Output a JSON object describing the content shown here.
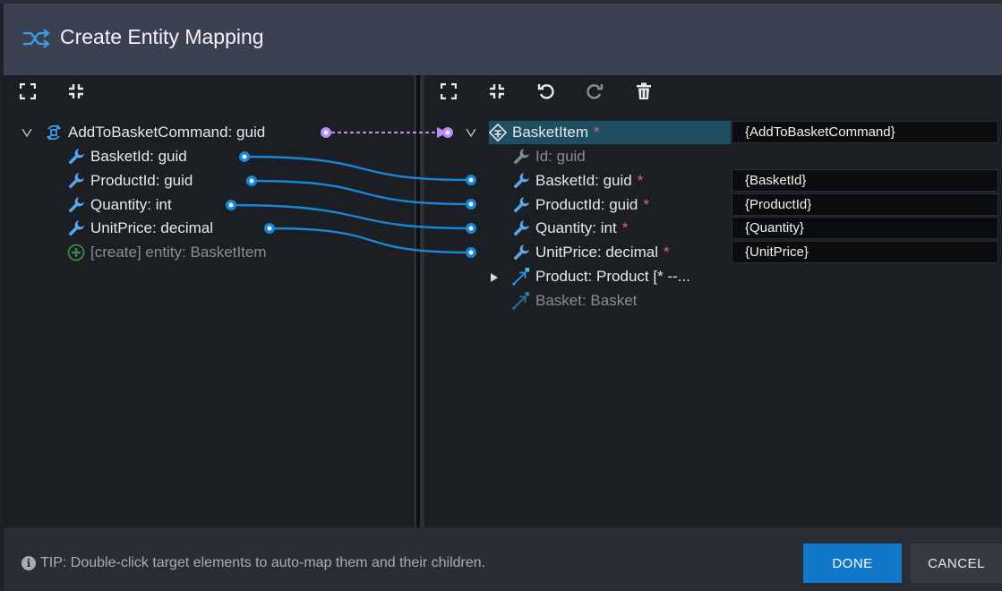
{
  "dialog": {
    "title": "Create Entity Mapping"
  },
  "source_tree": {
    "root": {
      "label": "AddToBasketCommand: guid"
    },
    "children": [
      {
        "label": "BasketId: guid"
      },
      {
        "label": "ProductId: guid"
      },
      {
        "label": "Quantity: int"
      },
      {
        "label": "UnitPrice: decimal"
      },
      {
        "label": "[create] entity: BasketItem"
      }
    ]
  },
  "target_tree": {
    "root": {
      "label": "BasketItem",
      "required": "*",
      "value": "{AddToBasketCommand}"
    },
    "children": [
      {
        "label": "Id: guid",
        "required": "",
        "value": ""
      },
      {
        "label": "BasketId: guid",
        "required": "*",
        "value": "{BasketId}"
      },
      {
        "label": "ProductId: guid",
        "required": "*",
        "value": "{ProductId}"
      },
      {
        "label": "Quantity: int",
        "required": "*",
        "value": "{Quantity}"
      },
      {
        "label": "UnitPrice: decimal",
        "required": "*",
        "value": "{UnitPrice}"
      },
      {
        "label": "Product: Product [* --...",
        "required": "",
        "value": ""
      },
      {
        "label": "Basket: Basket",
        "required": "",
        "value": ""
      }
    ]
  },
  "footer": {
    "tip_text": "TIP: Double-click target elements to auto-map them and their children.",
    "done_label": "DONE",
    "cancel_label": "CANCEL"
  },
  "colors": {
    "accent": "#1177c9",
    "connector": "#1a86d6",
    "dotted_connector": "#b98cf0",
    "selection": "#1f4e63",
    "required": "#e06a6a"
  },
  "icons": {
    "title": "shuffle-icon",
    "expand": "expand-icon",
    "collapse": "collapse-icon",
    "undo": "undo-icon",
    "redo": "redo-icon",
    "delete": "trash-icon",
    "attribute": "wrench-icon",
    "create": "plus-circle-icon",
    "association": "association-arrow-icon"
  }
}
